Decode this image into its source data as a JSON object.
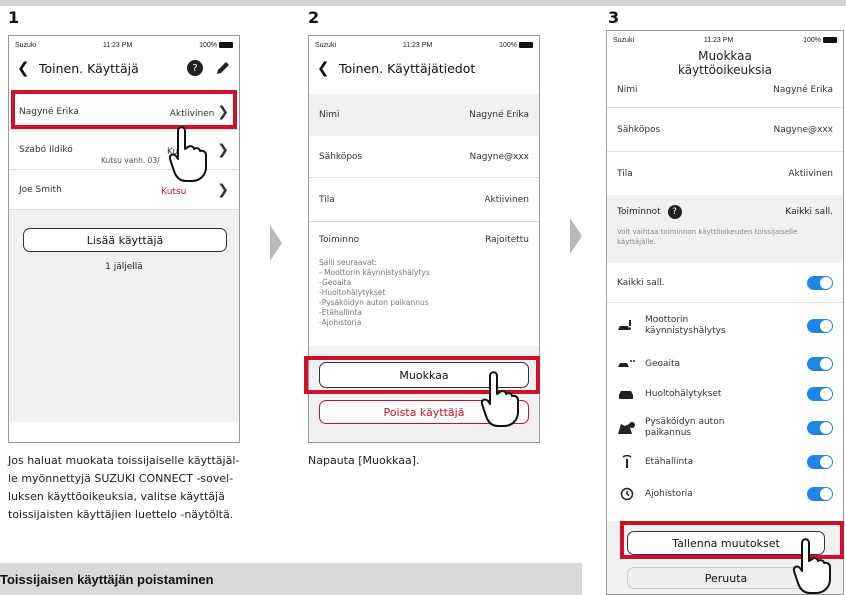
{
  "steps": [
    "1",
    "2",
    "3"
  ],
  "status": {
    "carrier": "Suzuki",
    "time": "11:23 PM",
    "battery": "100%"
  },
  "screen1": {
    "title": "Toinen. Käyttäjä",
    "users": [
      {
        "name": "Nagyné Erika",
        "status": "Aktiivinen",
        "sub": ""
      },
      {
        "name": "Szabó Ildikó",
        "status": "Kuts",
        "sub": "Kutsu vanh. 03/"
      },
      {
        "name": "Joe Smith",
        "status": "Kutsu",
        "sub": ""
      }
    ],
    "add_button": "Lisää käyttäjä",
    "remaining": "1 jäljellä"
  },
  "screen2": {
    "title": "Toinen. Käyttäjätiedot",
    "fields": [
      {
        "label": "Nimi",
        "value": "Nagyné Erika"
      },
      {
        "label": "Sähköpos",
        "value": "Nagyne@xxx"
      },
      {
        "label": "Tila",
        "value": "Aktiivinen"
      },
      {
        "label": "Toiminno",
        "value": "Rajoitettu"
      }
    ],
    "allowed_title": "Salli seuraavat:",
    "allowed": [
      "- Moottorin käynnistyshälytys",
      "-Geoaita",
      "-Huoltohälytykset",
      "-Pysäköidyn auton paikannus",
      "-Etähallinta",
      "-Ajohistoria"
    ],
    "edit_button": "Muokkaa",
    "delete_button": "Poista käyttäjä"
  },
  "screen3": {
    "title": "Muokkaa\nkäyttöoikeuksia",
    "fields": [
      {
        "label": "Nimi",
        "value": "Nagyné Erika"
      },
      {
        "label": "Sähköpos",
        "value": "Nagyne@xxx"
      },
      {
        "label": "Tila",
        "value": "Aktiivinen"
      }
    ],
    "functions_label": "Toiminnot",
    "functions_value": "Kaikki sall.",
    "functions_hint": "Voit vaihtaa toiminnon käyttöoikeuden toissijaiselle käyttäjälle.",
    "allow_all": "Kaikki sall.",
    "permissions": [
      {
        "label": "Moottorin\nkäynnistyshälytys",
        "icon": "car-alert-icon"
      },
      {
        "label": "Geoaita",
        "icon": "geofence-car-icon"
      },
      {
        "label": "Huoltohälytykset",
        "icon": "car-service-icon"
      },
      {
        "label": "Pysäköidyn auton\npaikannus",
        "icon": "map-pin-icon"
      },
      {
        "label": "Etähallinta",
        "icon": "remote-signal-icon"
      },
      {
        "label": "Ajohistoria",
        "icon": "history-icon"
      }
    ],
    "save_button": "Tallenna muutokset",
    "cancel_button": "Peruuta"
  },
  "captions": {
    "step1": "Jos haluat muokata toissijaiselle käyttäjäl-\nle myönnettyjä SUZUKI CONNECT -sovel-\nluksen käyttöoikeuksia, valitse käyttäjä\ntoissijaisten käyttäjien luettelo -näytöltä.",
    "step2": "Napauta [Muokkaa].",
    "section": "Toissijaisen käyttäjän poistaminen"
  },
  "colors": {
    "accent_red": "#d0102a",
    "toggle_blue": "#1e86e6",
    "grey_bg": "#f1f1f1"
  }
}
